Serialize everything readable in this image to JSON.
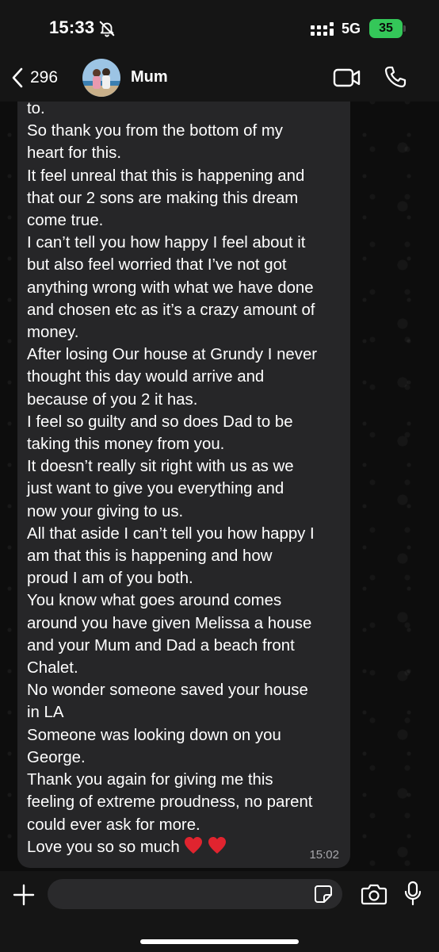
{
  "status_bar": {
    "time": "15:33",
    "network": "5G",
    "battery": "35",
    "icons": [
      "bell-slash-icon",
      "signal-icon",
      "battery-icon"
    ]
  },
  "header": {
    "back_count": "296",
    "contact_name": "Mum",
    "icons": [
      "chevron-left-icon",
      "video-camera-icon",
      "phone-icon"
    ]
  },
  "message": {
    "lines": [
      "to.",
      "So thank you from the bottom of my",
      "heart for this.",
      "It feel unreal that this is happening and",
      "that our 2 sons are making this dream",
      "come true.",
      "I can’t tell you how happy I feel about it",
      "but also feel worried that I’ve not got",
      "anything wrong with what we have done",
      "and chosen etc as it’s a crazy amount of",
      "money.",
      "After losing Our house at Grundy I never",
      "thought this day would arrive and",
      "because of you 2 it has.",
      "I feel so guilty and so does Dad to be",
      "taking this money from you.",
      "It doesn’t really sit right with us as we",
      "just want to give you everything and",
      "now your giving to us.",
      "All that aside I can’t tell you how happy I",
      "am that this is happening and how",
      "proud I am of you both.",
      "You know what goes around comes",
      "around you have given Melissa a house",
      "and your Mum and Dad a beach front",
      "Chalet.",
      "No wonder someone saved your house",
      "in LA",
      "Someone was looking down on you",
      "George.",
      "Thank you again for giving me this",
      "feeling of extreme proudness, no parent",
      "could ever ask for more."
    ],
    "last_line": "Love you so so much",
    "emoji": [
      "heart-emoji",
      "heart-emoji"
    ],
    "timestamp": "15:02"
  },
  "input_bar": {
    "value": "",
    "icons": [
      "plus-icon",
      "sticker-icon",
      "camera-icon",
      "microphone-icon"
    ]
  },
  "colors": {
    "battery": "#34c759",
    "bubble": "#262628",
    "bars": "#151515",
    "heart": "#e0242f"
  }
}
